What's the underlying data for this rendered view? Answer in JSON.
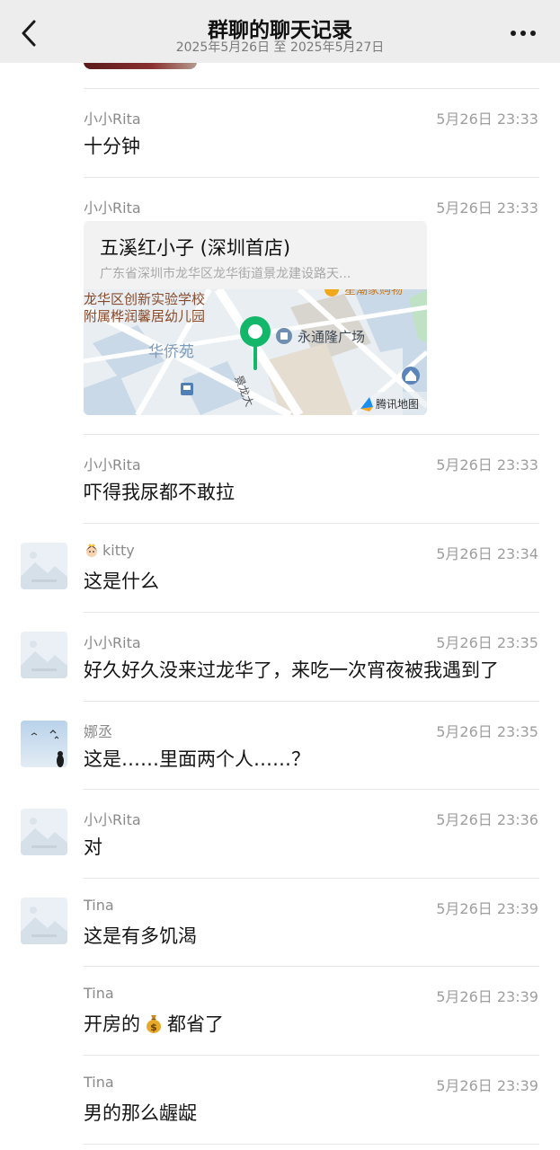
{
  "header": {
    "title": "群聊的聊天记录",
    "subtitle": "2025年5月26日 至 2025年5月27日",
    "back_icon": "chevron-left-icon",
    "more_icon": "more-dots-icon"
  },
  "messages": [
    {
      "sender": "小小Rita",
      "time": "5月26日 23:33",
      "text": "十分钟"
    },
    {
      "sender": "小小Rita",
      "time": "5月26日 23:33",
      "location": {
        "name": "五溪红小子 (深圳首店)",
        "address": "广东省深圳市龙华区龙华街道景龙建设路天...",
        "map_labels": {
          "school_line1": "龙华区创新实验学校",
          "school_line2": "附属桦润馨居幼儿园",
          "area": "华侨苑",
          "plaza": "永通隆广场",
          "street": "景龙大",
          "mall": "星潮家购物",
          "brand": "腾讯地图"
        }
      }
    },
    {
      "sender": "小小Rita",
      "time": "5月26日 23:33",
      "text": "吓得我尿都不敢拉"
    },
    {
      "sender": "kitty",
      "sender_prefix_icon": "princess-emoji-icon",
      "time": "5月26日 23:34",
      "text": "这是什么"
    },
    {
      "sender": "小小Rita",
      "time": "5月26日 23:35",
      "text": "好久好久没来过龙华了，来吃一次宵夜被我遇到了"
    },
    {
      "sender": "娜丞",
      "time": "5月26日 23:35",
      "text": "这是……里面两个人……？"
    },
    {
      "sender": "小小Rita",
      "time": "5月26日 23:36",
      "text": "对"
    },
    {
      "sender": "Tina",
      "time": "5月26日 23:39",
      "text": "这是有多饥渴"
    },
    {
      "sender": "Tina",
      "time": "5月26日 23:39",
      "text_before": "开房的",
      "emoji": "money-bag-icon",
      "text_after": "都省了"
    },
    {
      "sender": "Tina",
      "time": "5月26日 23:39",
      "text": "男的那么龌龊"
    }
  ],
  "colors": {
    "header_bg": "#ededed",
    "pin_green": "#12b76a",
    "map_bg": "#e9eef2",
    "map_building": "#c9d9e8",
    "divider": "#e6e6e6"
  }
}
